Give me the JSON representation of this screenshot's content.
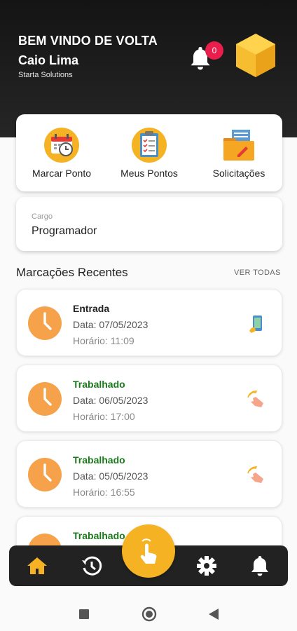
{
  "header": {
    "greeting": "BEM VINDO DE VOLTA",
    "user_name": "Caio Lima",
    "company": "Starta Solutions",
    "notification_count": "0"
  },
  "actions": [
    {
      "label": "Marcar Ponto",
      "icon": "calendar-clock-icon"
    },
    {
      "label": "Meus Pontos",
      "icon": "clipboard-checklist-icon"
    },
    {
      "label": "Solicitações",
      "icon": "folder-document-icon"
    }
  ],
  "cargo": {
    "label": "Cargo",
    "value": "Programador"
  },
  "recent": {
    "title": "Marcações Recentes",
    "see_all": "VER TODAS",
    "items": [
      {
        "type": "Entrada",
        "date": "Data: 07/05/2023",
        "time": "Horário: 11:09",
        "icon": "phone-tap-icon"
      },
      {
        "type": "Trabalhado",
        "date": "Data: 06/05/2023",
        "time": "Horário: 17:00",
        "icon": "hand-tap-icon"
      },
      {
        "type": "Trabalhado",
        "date": "Data: 05/05/2023",
        "time": "Horário: 16:55",
        "icon": "hand-tap-icon"
      },
      {
        "type": "Trabalhado"
      }
    ]
  },
  "bottom_nav": [
    "home-icon",
    "history-icon",
    "punch-fab-icon",
    "settings-icon",
    "notifications-icon"
  ],
  "colors": {
    "accent": "#f5b323",
    "header_bg": "#1c1c1c",
    "green": "#1b7a1b",
    "badge": "#e91e4c"
  }
}
